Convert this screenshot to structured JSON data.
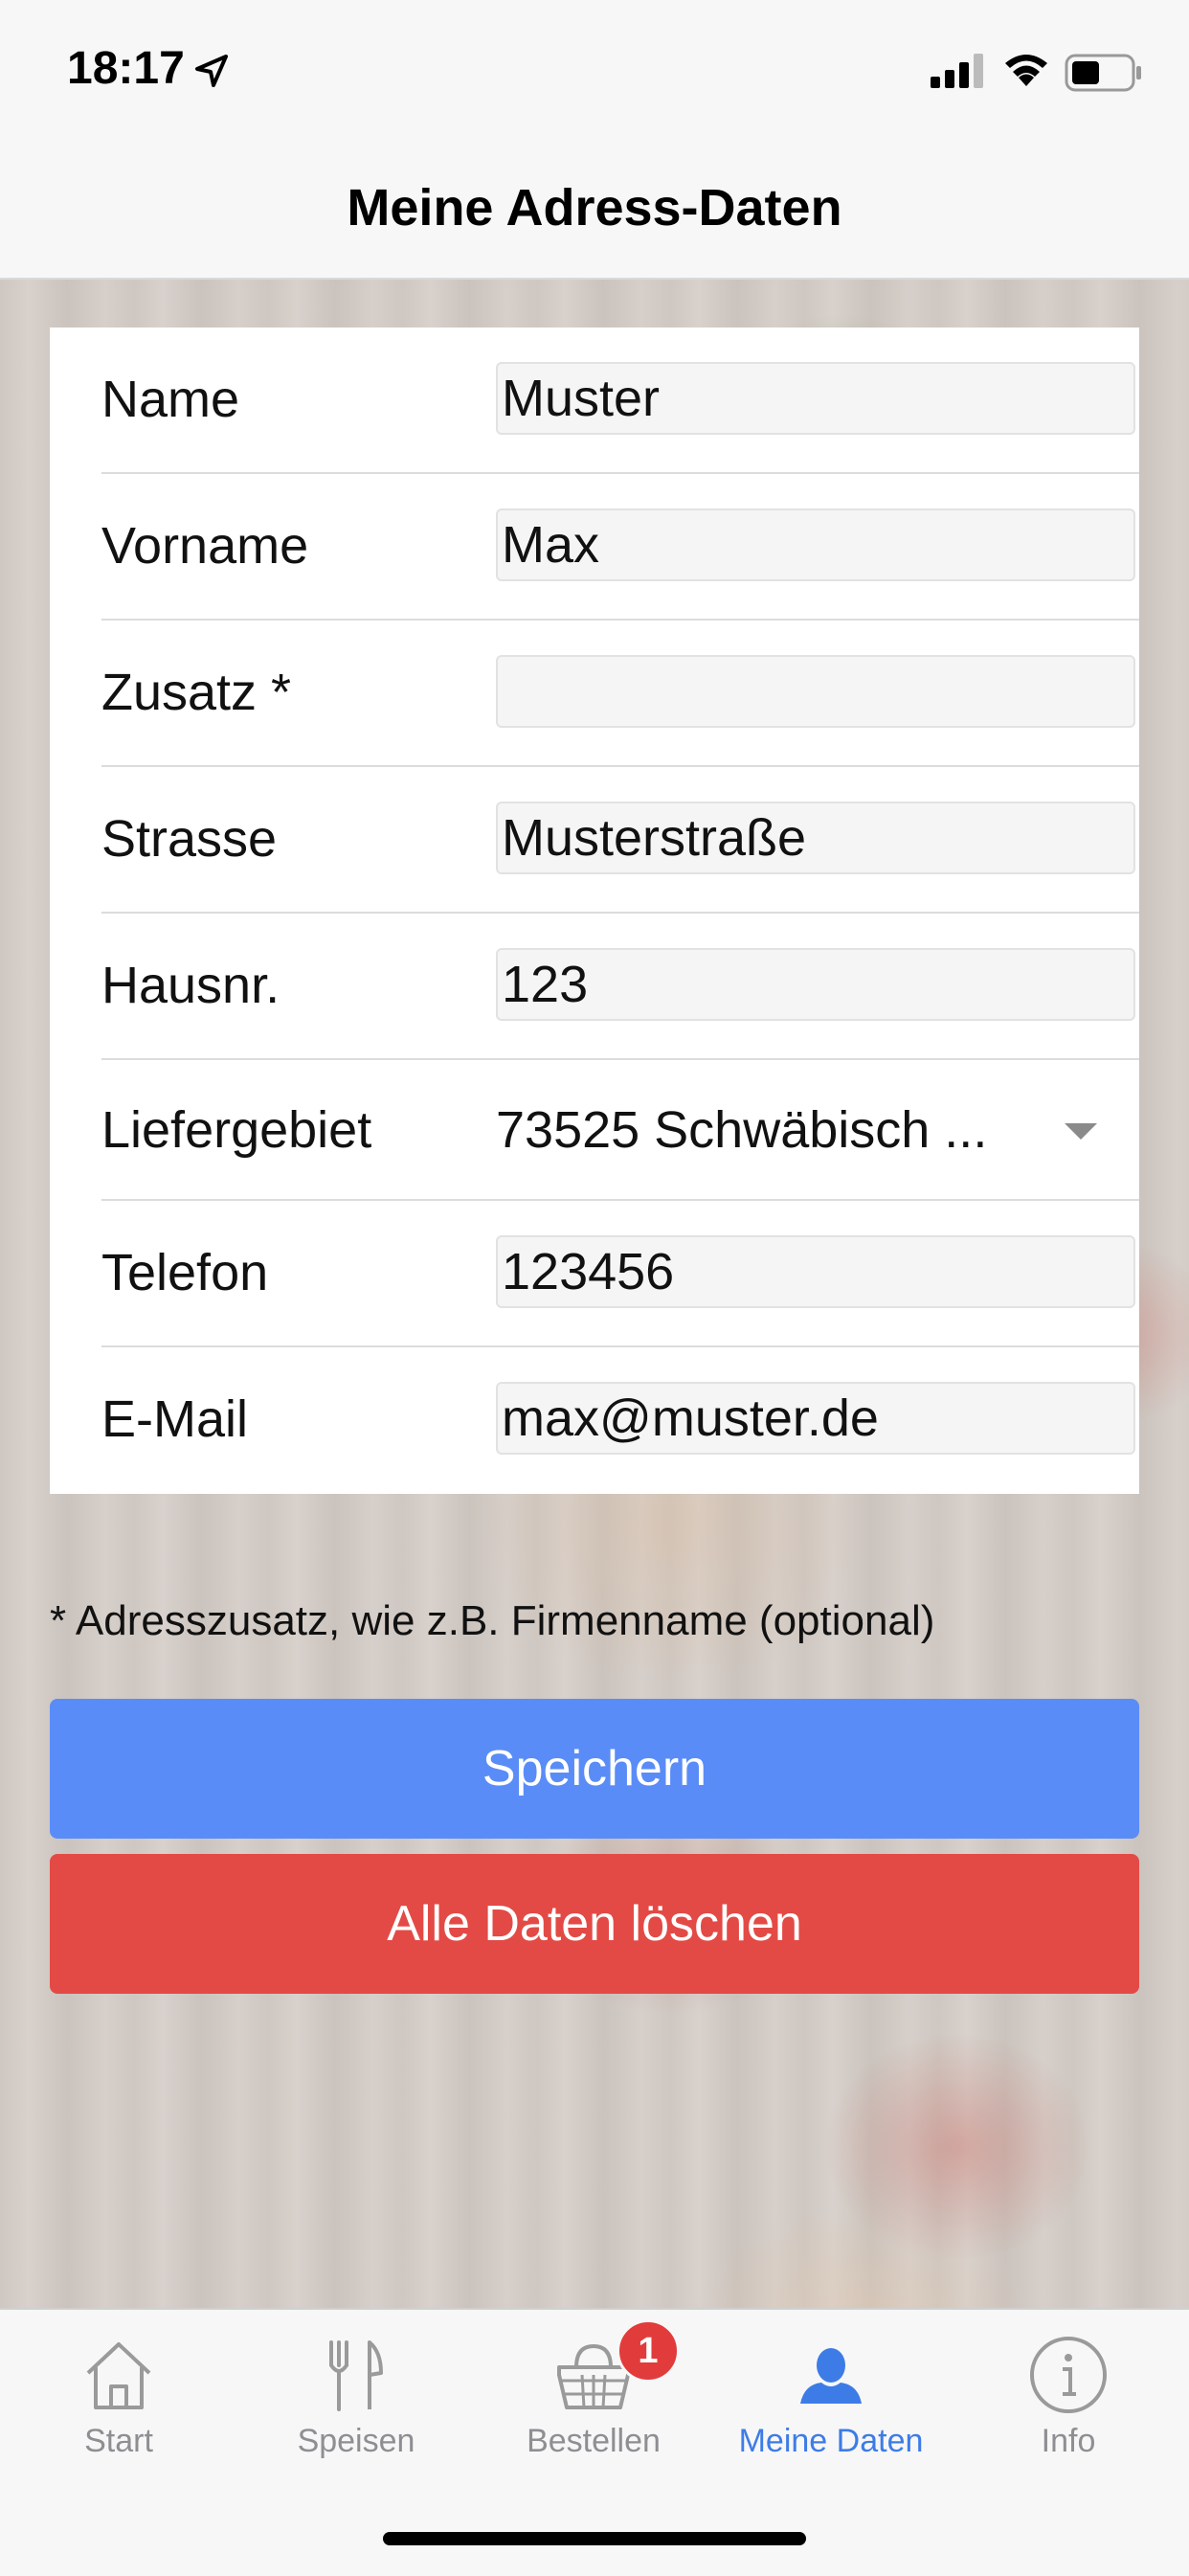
{
  "status_bar": {
    "time": "18:17"
  },
  "nav": {
    "title": "Meine Adress-Daten"
  },
  "form": {
    "rows": [
      {
        "label": "Name",
        "value": "Muster"
      },
      {
        "label": "Vorname",
        "value": "Max"
      },
      {
        "label": "Zusatz *",
        "value": ""
      },
      {
        "label": "Strasse",
        "value": "Musterstraße"
      },
      {
        "label": "Hausnr.",
        "value": "123"
      },
      {
        "label": "Liefergebiet",
        "value": "73525 Schwäbisch ..."
      },
      {
        "label": "Telefon",
        "value": "123456"
      },
      {
        "label": "E-Mail",
        "value": "max@muster.de"
      }
    ]
  },
  "note": "* Adresszusatz, wie z.B. Firmenname (optional)",
  "buttons": {
    "save": "Speichern",
    "delete": "Alle Daten löschen"
  },
  "tabs": [
    {
      "label": "Start",
      "icon": "home-icon"
    },
    {
      "label": "Speisen",
      "icon": "cutlery-icon"
    },
    {
      "label": "Bestellen",
      "icon": "basket-icon",
      "badge": "1"
    },
    {
      "label": "Meine Daten",
      "icon": "user-icon",
      "active": true
    },
    {
      "label": "Info",
      "icon": "info-icon"
    }
  ],
  "colors": {
    "accent": "#3d7ce6",
    "save": "#5a8cf7",
    "delete": "#e34a45",
    "badge": "#e23b3b"
  }
}
